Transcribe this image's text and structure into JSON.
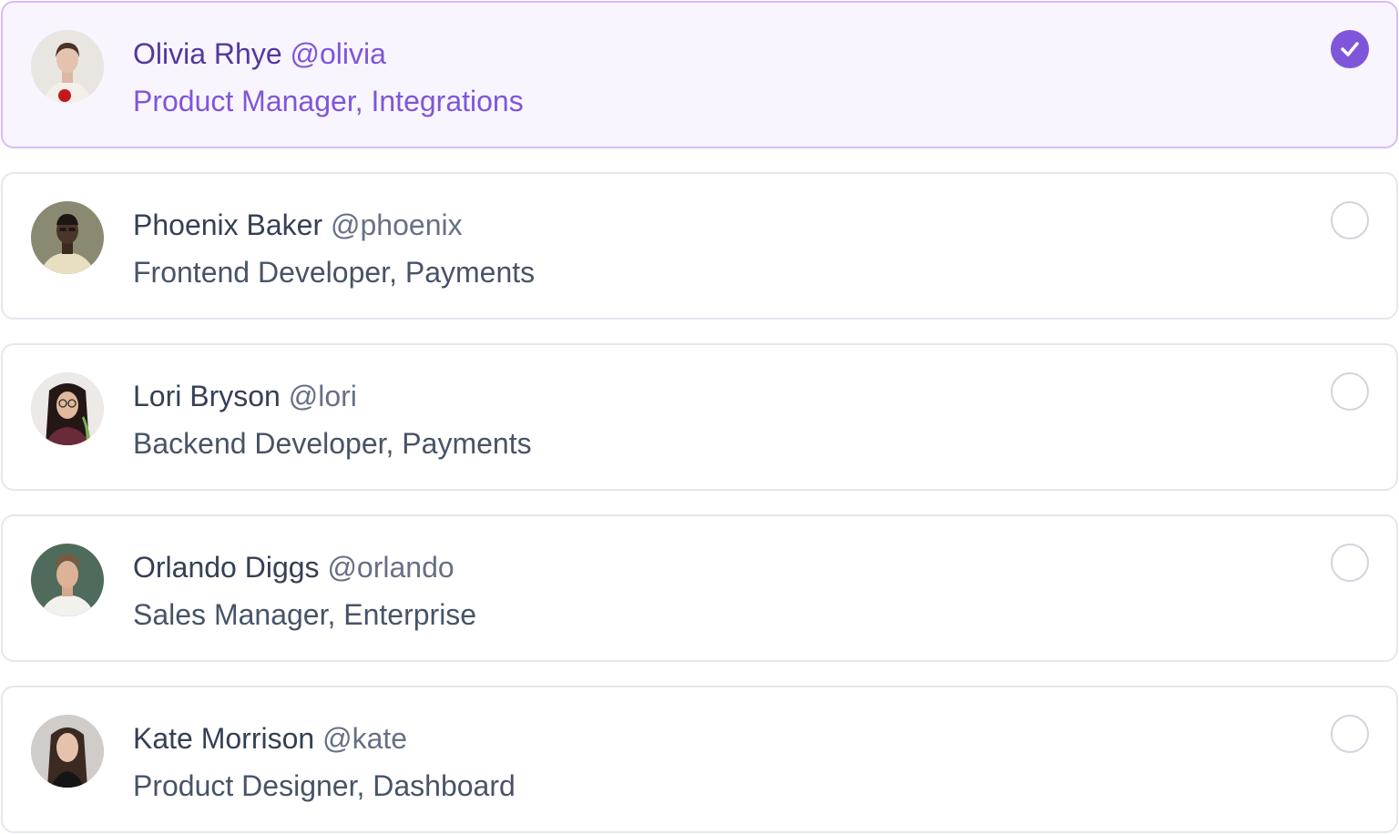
{
  "accent_color": "#7f56d9",
  "users": [
    {
      "name": "Olivia Rhye",
      "handle": "@olivia",
      "role": "Product Manager, Integrations",
      "selected": true
    },
    {
      "name": "Phoenix Baker",
      "handle": "@phoenix",
      "role": "Frontend Developer, Payments",
      "selected": false
    },
    {
      "name": "Lori Bryson",
      "handle": "@lori",
      "role": "Backend Developer, Payments",
      "selected": false
    },
    {
      "name": "Orlando Diggs",
      "handle": "@orlando",
      "role": "Sales Manager, Enterprise",
      "selected": false
    },
    {
      "name": "Kate Morrison",
      "handle": "@kate",
      "role": "Product Designer, Dashboard",
      "selected": false
    }
  ]
}
